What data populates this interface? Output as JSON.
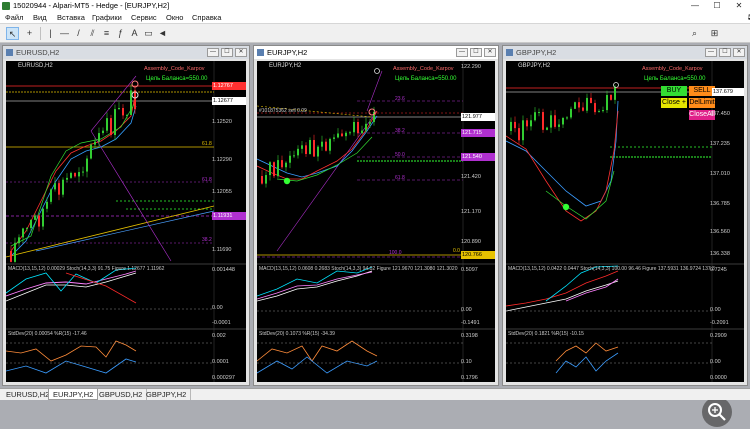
{
  "app": {
    "title": "15020944 - Alpari-MT5 - Hedge - [EURJPY,H2]",
    "min_glyph": "—",
    "max_glyph": "☐",
    "close_glyph": "✕"
  },
  "menu": [
    "Файл",
    "Вид",
    "Вставка",
    "Графики",
    "Сервис",
    "Окно",
    "Справка"
  ],
  "toolbar": {
    "icons": [
      "cursor-icon",
      "crosshair-icon",
      "vertical-line-icon",
      "horizontal-line-icon",
      "trendline-icon",
      "channel-icon",
      "fibonacci-icon",
      "fibonacci-extension-icon",
      "text-icon",
      "shapes-icon",
      "arrow-icon",
      "search-icon",
      "tiles-icon"
    ],
    "glyphs": [
      "↖",
      "+",
      "|",
      "—",
      "/",
      "⫽",
      "≡",
      "ƒ",
      "A",
      "▭",
      "◄",
      "⌕",
      "⊞"
    ]
  },
  "charts": [
    {
      "title": "EURUSD,H2",
      "symbol_label": "EURUSD,H2",
      "goal": "Цель Баланса=550.00",
      "assembly": "Assembly_Code_Karpov",
      "macd_label": "MACD(13,15,12) 0.00029 Stoch(14,3,3) 91.75 Figure 1.12677 1.11962",
      "stddev_label": "StdDev(20) 0.00054 %R(15) -17.46",
      "prices": [
        "1.12767",
        "1.12677",
        "1.12520",
        "1.12290",
        "1.12055",
        "1.11931",
        "1.11690"
      ],
      "price_tags": {
        "red": "1.12767",
        "white": "1.12677",
        "purple": "1.11931"
      },
      "fib_levels": [
        "61.8",
        "61.8",
        "38.2"
      ],
      "sub_scale": [
        "0.001448",
        "0.00",
        "-0.0001",
        "0.002",
        "0.0001",
        "0.000297"
      ]
    },
    {
      "title": "EURJPY,H2",
      "symbol_label": "EURJPY,H2",
      "goal": "Цель Баланса=550.00",
      "assembly": "Assembly_Code_Karpov",
      "order_label": "#101875362 sell 0.09",
      "macd_label": "MACD(13,15,12) 0.0608 0.2683 Stoch(14,3,3) 94.02 Figure 121.9670 121.3080 121.3020",
      "stddev_label": "StdDev(20) 0.1073 %R(15) -34.39",
      "prices": [
        "122.290",
        "121.977",
        "121.715",
        "121.540",
        "121.420",
        "121.170",
        "120.890",
        "120.766"
      ],
      "price_tags": {
        "white": "121.977",
        "purple1": "121.715",
        "purple2": "121.540",
        "yellow": "120.766"
      },
      "fib_levels": [
        "23.6",
        "38.2",
        "50.0",
        "61.8",
        "100.0",
        "0.0"
      ],
      "sub_scale": [
        "0.5097",
        "0.00",
        "-0.1491",
        "0.3198",
        "0.10",
        "0.1796"
      ]
    },
    {
      "title": "GBPJPY,H2",
      "symbol_label": "GBPJPY,H2",
      "goal": "Цель Баланса=550.00",
      "assembly": "Assembly_Code_Karpov",
      "macd_label": "MACD(13,15,12) 0.0422 0.0447 Stoch(14,3,3) 100.00 96.46 Figure 137.5931 136.9724 137.3",
      "stddev_label": "StdDev(20) 0.1821 %R(15) -10.15",
      "prices": [
        "137.679",
        "137.450",
        "137.235",
        "137.010",
        "136.785",
        "136.560",
        "136.338"
      ],
      "price_tags": {
        "white": "137.679"
      },
      "buttons": {
        "buy": "BUY",
        "sell": "SELL",
        "close": "Close +",
        "dellimit": "DelLimit",
        "closeall": "CloseAll"
      },
      "sub_scale": [
        "0.7245",
        "0.00",
        "-0.2091",
        "0.2909",
        "0.00",
        "0.0000"
      ]
    }
  ],
  "tabs": [
    "EURUSD,H2",
    "EURJPY,H2",
    "GBPUSD,H2",
    "GBPJPY,H2"
  ],
  "active_tab": "EURJPY,H2",
  "colors": {
    "bull": "#32cd32",
    "bear": "#ff2a2a",
    "goal": "#33ff33",
    "fib": "#b030d0",
    "macd": "#00e5ff",
    "stoch": "#ff9f40"
  }
}
